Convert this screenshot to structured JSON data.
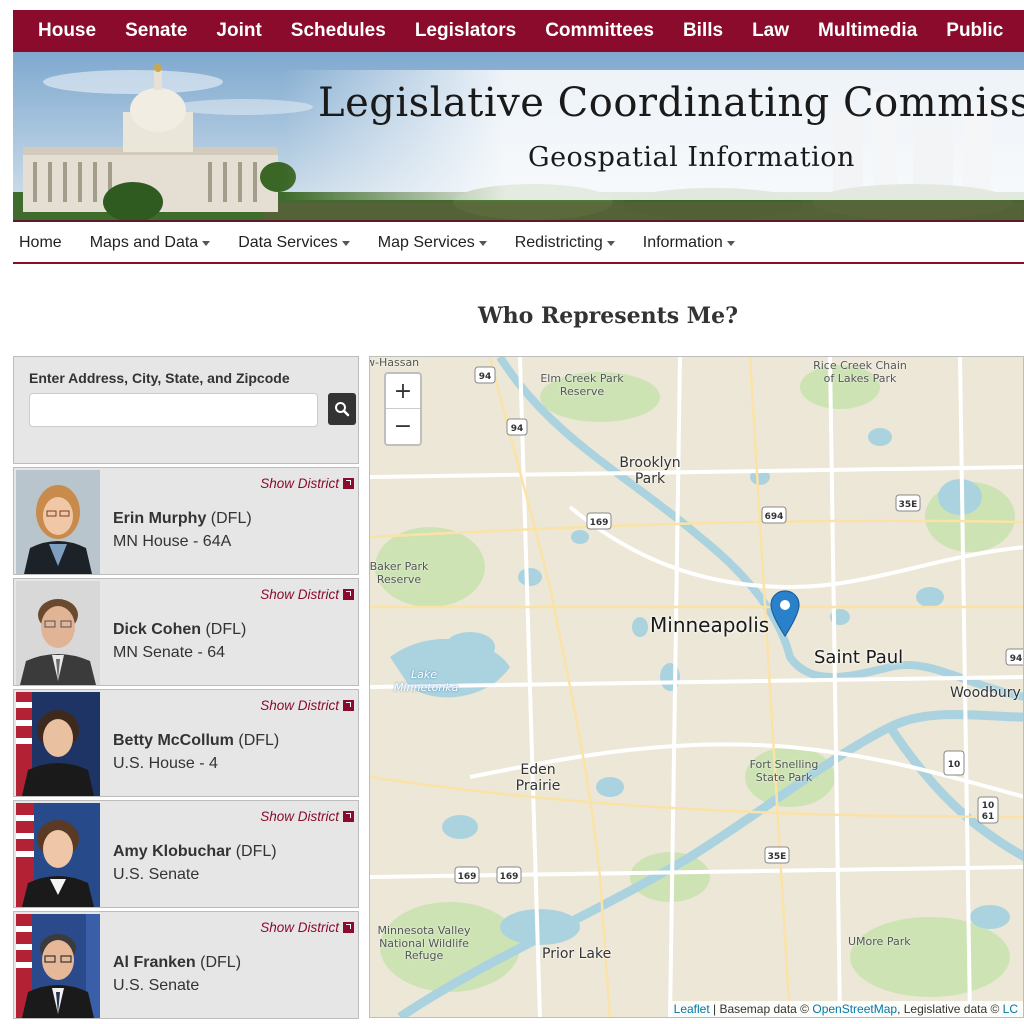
{
  "top_nav": [
    "House",
    "Senate",
    "Joint",
    "Schedules",
    "Legislators",
    "Committees",
    "Bills",
    "Law",
    "Multimedia",
    "Public"
  ],
  "banner": {
    "title": "Legislative Coordinating Commiss",
    "subtitle": "Geospatial Information"
  },
  "sub_nav": [
    {
      "label": "Home",
      "dropdown": false
    },
    {
      "label": "Maps and Data",
      "dropdown": true
    },
    {
      "label": "Data Services",
      "dropdown": true
    },
    {
      "label": "Map Services",
      "dropdown": true
    },
    {
      "label": "Redistricting",
      "dropdown": true
    },
    {
      "label": "Information",
      "dropdown": true
    }
  ],
  "page_title": "Who Represents Me?",
  "search": {
    "label": "Enter Address, City, State, and Zipcode",
    "value": "",
    "placeholder": "",
    "button_icon": "search-icon"
  },
  "show_district_label": "Show District",
  "legislators": [
    {
      "name": "Erin Murphy",
      "party": "(DFL)",
      "district": "MN House - 64A"
    },
    {
      "name": "Dick Cohen",
      "party": "(DFL)",
      "district": "MN Senate - 64"
    },
    {
      "name": "Betty McCollum",
      "party": "(DFL)",
      "district": "U.S. House - 4"
    },
    {
      "name": "Amy Klobuchar",
      "party": "(DFL)",
      "district": "U.S. Senate"
    },
    {
      "name": "Al Franken",
      "party": "(DFL)",
      "district": "U.S. Senate"
    }
  ],
  "map": {
    "zoom_in": "+",
    "zoom_out": "−",
    "places": {
      "hassan": "w-Hassan",
      "elm_creek": "Elm Creek Park Reserve",
      "rice_creek": "Rice Creek Chain of Lakes Park",
      "brooklyn_park": "Brooklyn Park",
      "baker_park": "Baker Park Reserve",
      "minneapolis": "Minneapolis",
      "saint_paul": "Saint Paul",
      "lake_minnetonka": "Lake Minnetonka",
      "woodbury": "Woodbury",
      "eden_prairie": "Eden Prairie",
      "fort_snelling": "Fort Snelling State Park",
      "mn_valley": "Minnesota Valley National Wildlife Refuge",
      "prior_lake": "Prior Lake",
      "umore": "UMore Park"
    },
    "shields": [
      "94",
      "94",
      "169",
      "694",
      "35E",
      "169",
      "169",
      "35E",
      "10",
      "10 61",
      "94"
    ],
    "attribution": {
      "leaflet": "Leaflet",
      "sep": " | Basemap data © ",
      "osm": "OpenStreetMap",
      "legis": ", Legislative data © ",
      "lcc": "LC"
    }
  },
  "colors": {
    "nav_red": "#8a0b2c",
    "link_red": "#8a0b2c",
    "panel_gray": "#e6e6e6",
    "water": "#abd3df",
    "land": "#ece7d6",
    "marker_blue": "#2a81cb"
  }
}
